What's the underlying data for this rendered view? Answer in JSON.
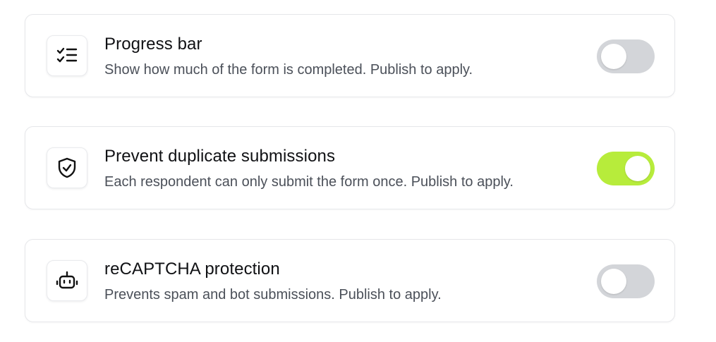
{
  "settings": [
    {
      "title": "Progress bar",
      "description": "Show how much of the form is completed. Publish to apply.",
      "icon": "checklist-icon",
      "enabled": false
    },
    {
      "title": "Prevent duplicate submissions",
      "description": "Each respondent can only submit the form once. Publish to apply.",
      "icon": "shield-check-icon",
      "enabled": true
    },
    {
      "title": "reCAPTCHA protection",
      "description": "Prevents spam and bot submissions. Publish to apply.",
      "icon": "robot-icon",
      "enabled": false
    }
  ],
  "colors": {
    "toggle_on": "#b7ec3b",
    "toggle_off": "#d3d5d9"
  }
}
